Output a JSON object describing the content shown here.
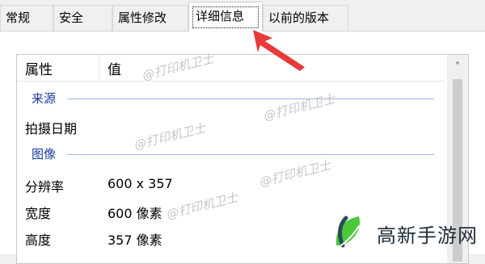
{
  "tabs": [
    {
      "label": "常规"
    },
    {
      "label": "安全"
    },
    {
      "label": "属性修改"
    },
    {
      "label": "详细信息"
    },
    {
      "label": "以前的版本"
    }
  ],
  "active_tab": "详细信息",
  "table": {
    "columns": [
      "属性",
      "值"
    ],
    "groups": {
      "source": {
        "label": "来源"
      },
      "image": {
        "label": "图像"
      }
    },
    "rows": [
      {
        "key": "拍摄日期",
        "value": ""
      },
      {
        "key": "分辨率",
        "value": "600 x 357"
      },
      {
        "key": "宽度",
        "value": "600 像素"
      },
      {
        "key": "高度",
        "value": "357 像素"
      }
    ]
  },
  "watermark": {
    "text": "@打印机卫士"
  },
  "brand": {
    "name": "高新手游网"
  },
  "colors": {
    "group_label": "#1a3b9c",
    "group_line": "#9fb4de",
    "arrow": "#e83a3a",
    "logo_green": "#4cc93a",
    "logo_dark": "#2b4a5a"
  },
  "icons": {
    "scroll_up": "chevron-up-icon",
    "annotation": "red-arrow",
    "logo": "leaf-logo"
  }
}
